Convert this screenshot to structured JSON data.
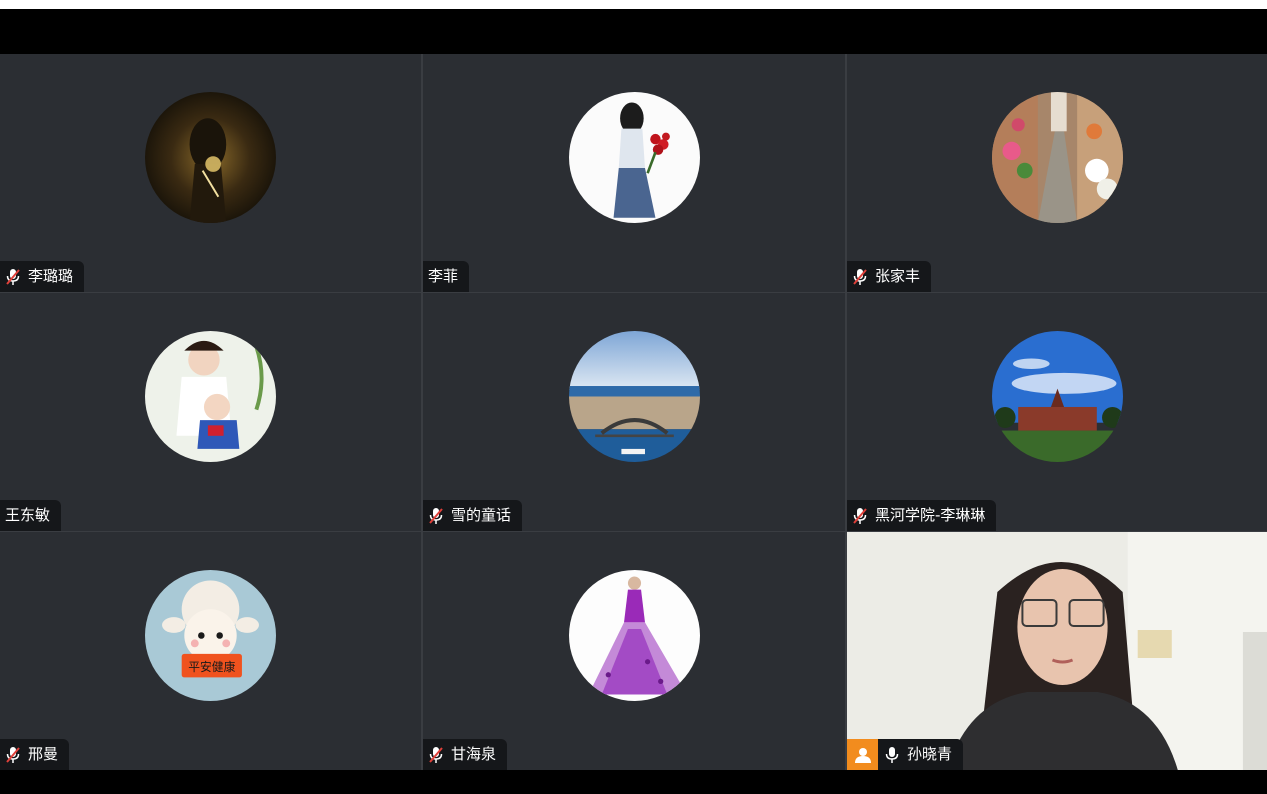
{
  "participants": [
    {
      "name": "李璐璐",
      "muted": true,
      "avatar": "dark-portrait-avatar"
    },
    {
      "name": "李菲",
      "muted": false,
      "avatar": "girl-with-roses-avatar"
    },
    {
      "name": "张家丰",
      "muted": true,
      "avatar": "flower-street-avatar"
    },
    {
      "name": "王东敏",
      "muted": false,
      "avatar": "mother-baby-avatar"
    },
    {
      "name": "雪的童话",
      "muted": true,
      "avatar": "harbor-city-avatar"
    },
    {
      "name": "黑河学院-李琳琳",
      "muted": true,
      "avatar": "blue-sky-building-avatar"
    },
    {
      "name": "邢曼",
      "muted": true,
      "avatar": "cartoon-lamb-avatar",
      "sign_text": "平安健康"
    },
    {
      "name": "甘海泉",
      "muted": true,
      "avatar": "purple-gown-avatar"
    }
  ],
  "self_view": {
    "name": "孙晓青",
    "muted": false,
    "icons": [
      "host-person-icon",
      "microphone-icon"
    ]
  },
  "colors": {
    "tile_bg": "#2b2e33",
    "nametag_bg": "#15171a",
    "host_badge": "#f28c1e",
    "mute_red": "#e0403a"
  }
}
